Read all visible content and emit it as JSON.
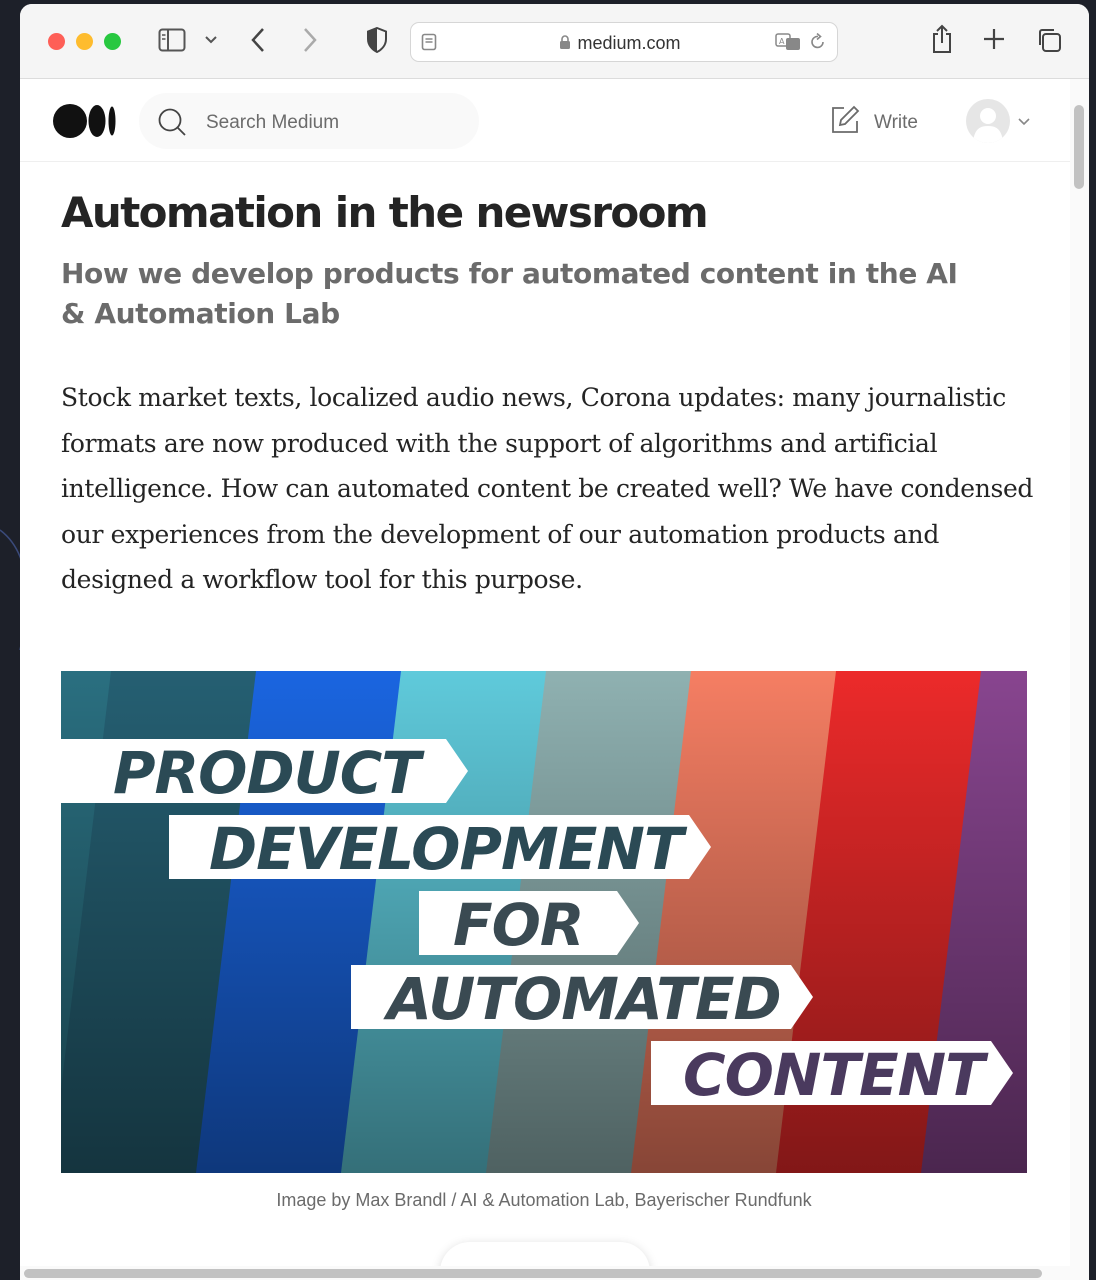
{
  "browser": {
    "url": "medium.com",
    "colors": {
      "close": "#fe5f57",
      "minimize": "#febc2e",
      "zoom": "#28c840"
    },
    "icons": [
      "sidebar-icon",
      "chevron-down-icon",
      "back-icon",
      "forward-icon",
      "shield-icon",
      "page-icon",
      "lock-icon",
      "translate-icon",
      "reload-icon",
      "share-icon",
      "plus-icon",
      "tabs-icon"
    ]
  },
  "header": {
    "search_placeholder": "Search Medium",
    "write_label": "Write"
  },
  "article": {
    "title": "Automation in the newsroom",
    "subtitle": "How we develop products for automated content in the AI & Automation Lab",
    "body": "Stock market texts, localized audio news, Corona updates: many journalistic formats are now produced with the support of algorithms and artificial intelligence. How can automated content be created well? We have condensed our experiences from the development of our automation products and designed a workflow tool for this purpose.",
    "image": {
      "lines": [
        "PRODUCT",
        "DEVELOPMENT",
        "FOR",
        "AUTOMATED",
        "CONTENT"
      ],
      "stripe_colors": [
        "#255f72",
        "#1a65e0",
        "#5fcadb",
        "#8fb1b1",
        "#f57e63",
        "#ec2a2a",
        "#88458f"
      ]
    },
    "caption": "Image by Max Brandl / AI & Automation Lab, Bayerischer Rundfunk"
  }
}
